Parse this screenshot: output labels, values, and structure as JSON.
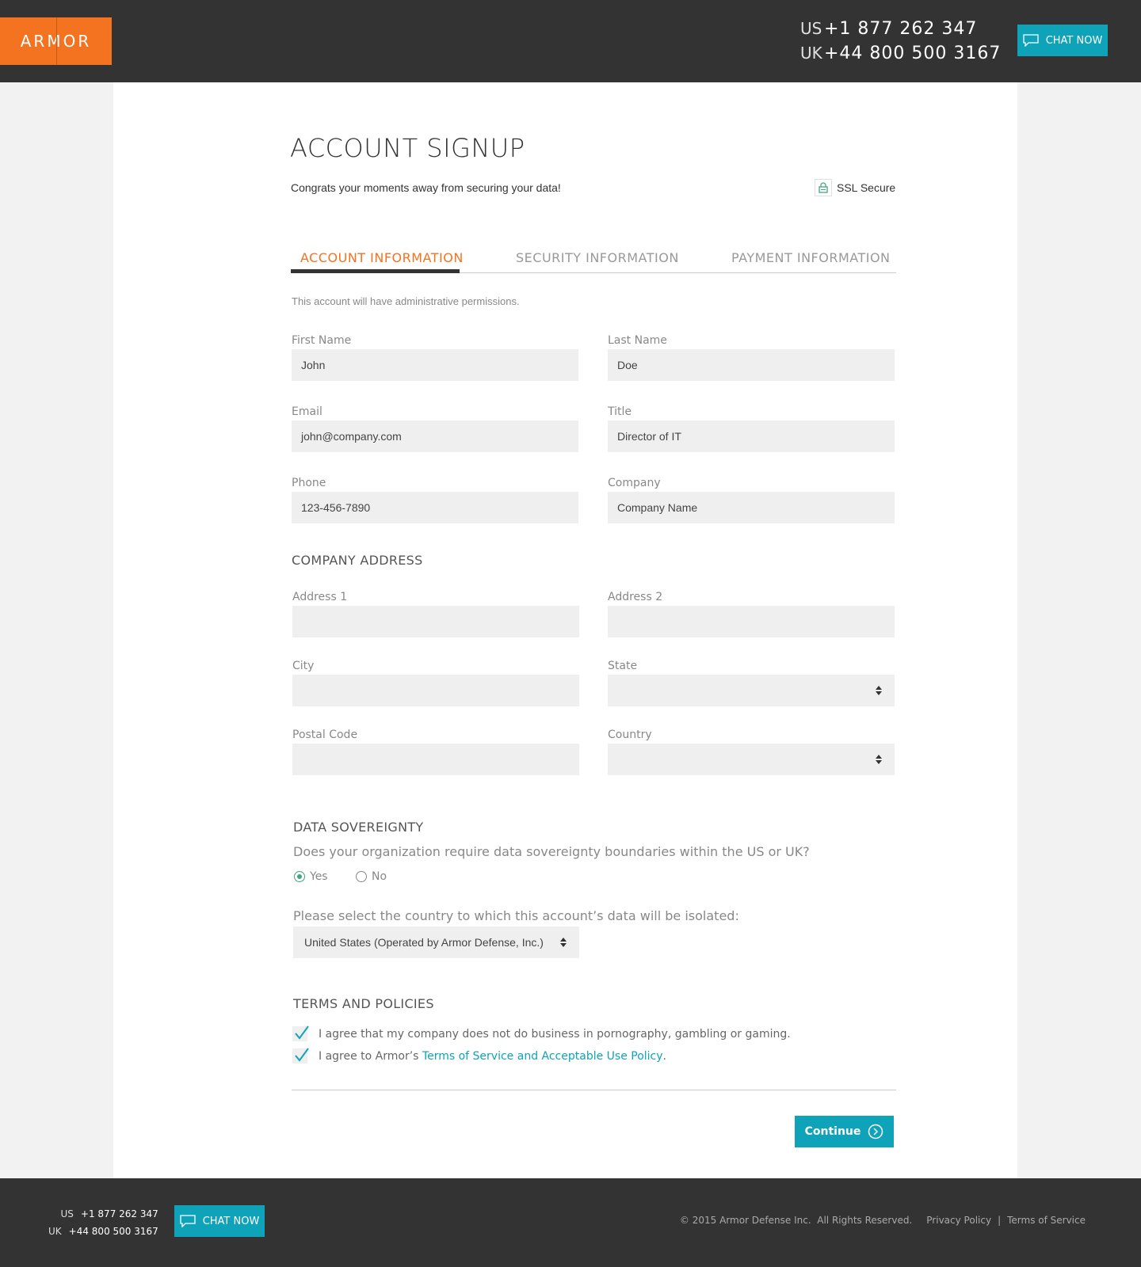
{
  "header": {
    "logo_text": "ARMOR",
    "us_code": "US",
    "us_phone": "+1 877 262 347",
    "uk_code": "UK",
    "uk_phone": "+44 800 500 3167",
    "chat_label": "CHAT NOW"
  },
  "page": {
    "title": "ACCOUNT SIGNUP",
    "subtitle": "Congrats your moments away from securing your data!",
    "ssl_label": "SSL Secure"
  },
  "tabs": [
    {
      "label": "ACCOUNT INFORMATION",
      "active": true
    },
    {
      "label": "SECURITY INFORMATION",
      "active": false
    },
    {
      "label": "PAYMENT INFORMATION",
      "active": false
    }
  ],
  "note": "This account will have administrative permissions.",
  "fields": {
    "first_name": {
      "label": "First Name",
      "value": "John"
    },
    "last_name": {
      "label": "Last Name",
      "value": "Doe"
    },
    "email": {
      "label": "Email",
      "value": "john@company.com"
    },
    "title": {
      "label": "Title",
      "value": "Director of IT"
    },
    "phone": {
      "label": "Phone",
      "value": "123-456-7890"
    },
    "company": {
      "label": "Company",
      "value": "Company Name"
    }
  },
  "address": {
    "section_title": "COMPANY ADDRESS",
    "address1": {
      "label": "Address 1",
      "value": ""
    },
    "address2": {
      "label": "Address 2",
      "value": ""
    },
    "city": {
      "label": "City",
      "value": ""
    },
    "state": {
      "label": "State",
      "value": ""
    },
    "postal": {
      "label": "Postal Code",
      "value": ""
    },
    "country": {
      "label": "Country",
      "value": ""
    }
  },
  "sovereignty": {
    "section_title": "DATA SOVEREIGNTY",
    "question": "Does your organization require data sovereignty boundaries within the US or UK?",
    "yes_label": "Yes",
    "no_label": "No",
    "selected": "Yes",
    "country_question": "Please select the country to which this account’s data will be isolated:",
    "country_value": "United States (Operated by Armor Defense, Inc.)"
  },
  "terms": {
    "section_title": "TERMS AND POLICIES",
    "agree1": "I agree that my company does not do business in pornography, gambling or gaming.",
    "agree2_prefix": "I agree to Armor’s ",
    "agree2_link": "Terms of Service and Acceptable Use Policy",
    "agree2_suffix": "."
  },
  "continue_label": "Continue",
  "footer": {
    "us_code": "US",
    "us_phone": "+1 877 262 347",
    "uk_code": "UK",
    "uk_phone": "+44 800 500 3167",
    "chat_label": "CHAT NOW",
    "copyright": "© 2015 Armor Defense Inc.  All Rights Reserved.",
    "privacy": "Privacy Policy",
    "separator": "|",
    "terms": "Terms of Service"
  },
  "colors": {
    "brand_orange": "#f37321",
    "accent_teal": "#0fa3b9",
    "dark_bar": "#333333",
    "radio_green": "#3fa77e"
  }
}
